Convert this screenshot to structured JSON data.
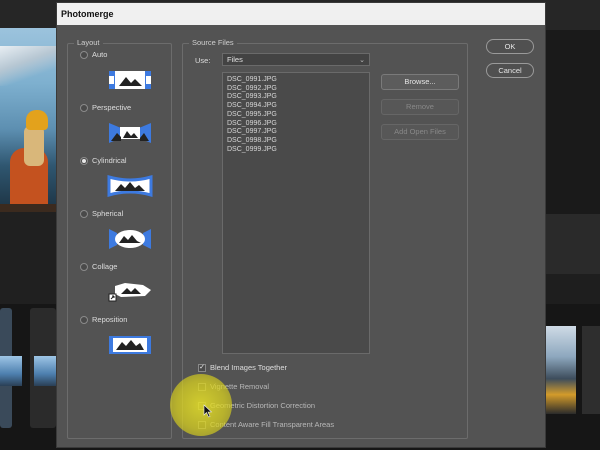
{
  "dialog": {
    "title": "Photomerge",
    "layout": {
      "label": "Layout",
      "options": [
        {
          "label": "Auto",
          "checked": false,
          "icon": "auto-layout-icon"
        },
        {
          "label": "Perspective",
          "checked": false,
          "icon": "perspective-layout-icon"
        },
        {
          "label": "Cylindrical",
          "checked": true,
          "icon": "cylindrical-layout-icon"
        },
        {
          "label": "Spherical",
          "checked": false,
          "icon": "spherical-layout-icon"
        },
        {
          "label": "Collage",
          "checked": false,
          "icon": "collage-layout-icon"
        },
        {
          "label": "Reposition",
          "checked": false,
          "icon": "reposition-layout-icon"
        }
      ]
    },
    "source": {
      "label": "Source Files",
      "use_label": "Use:",
      "use_value": "Files",
      "files": [
        "DSC_0991.JPG",
        "DSC_0992.JPG",
        "DSC_0993.JPG",
        "DSC_0994.JPG",
        "DSC_0995.JPG",
        "DSC_0996.JPG",
        "DSC_0997.JPG",
        "DSC_0998.JPG",
        "DSC_0999.JPG"
      ],
      "browse_label": "Browse...",
      "remove_label": "Remove",
      "add_open_label": "Add Open Files"
    },
    "options": [
      {
        "label": "Blend Images Together",
        "checked": true
      },
      {
        "label": "Vignette Removal",
        "checked": false
      },
      {
        "label": "Geometric Distortion Correction",
        "checked": false
      },
      {
        "label": "Content Aware Fill Transparent Areas",
        "checked": false
      }
    ],
    "ok_label": "OK",
    "cancel_label": "Cancel"
  },
  "colors": {
    "dialog_bg": "#535353",
    "icon_blue": "#3d7ae0",
    "highlight": "#e3dc24"
  }
}
